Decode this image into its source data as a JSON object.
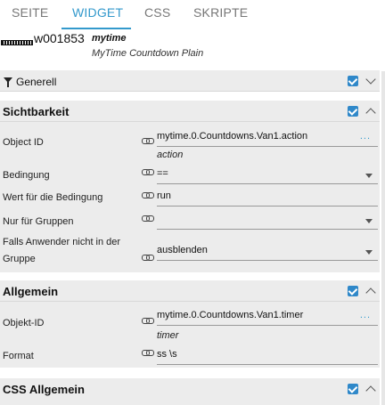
{
  "tabs": [
    {
      "label": "SEITE"
    },
    {
      "label": "WIDGET"
    },
    {
      "label": "CSS"
    },
    {
      "label": "SKRIPTE"
    }
  ],
  "active_tab": "WIDGET",
  "widget": {
    "id": "w001853",
    "set": "mytime",
    "name": "MyTime Countdown Plain"
  },
  "sections": {
    "generell": {
      "title": "Generell"
    },
    "sichtbarkeit": {
      "title": "Sichtbarkeit",
      "object_id_label": "Object ID",
      "object_id_value": "mytime.0.Countdowns.Van1.action",
      "object_id_sub": "action",
      "condition_label": "Bedingung",
      "condition_value": "==",
      "condition_value_label": "Wert für die Bedingung",
      "condition_value_value": "run",
      "groups_label": "Nur für Gruppen",
      "groups_value": "",
      "user_not_in_group_label_1": "Falls Anwender nicht in der",
      "user_not_in_group_label_2": "Gruppe",
      "user_not_in_group_value": "ausblenden"
    },
    "allgemein": {
      "title": "Allgemein",
      "oid_label": "Objekt-ID",
      "oid_value": "mytime.0.Countdowns.Van1.timer",
      "oid_sub": "timer",
      "format_label": "Format",
      "format_value": "ss \\s"
    },
    "css_allgemein": {
      "title": "CSS Allgemein"
    }
  },
  "ellipsis": "...",
  "accent": "#3399cc",
  "checkbox_color": "#2f88c9"
}
